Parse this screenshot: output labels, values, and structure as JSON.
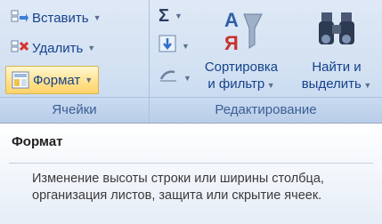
{
  "cells_group": {
    "insert_label": "Вставить",
    "delete_label": "Удалить",
    "format_label": "Формат",
    "caption": "Ячейки"
  },
  "editing_group": {
    "sum_icon": "Σ",
    "sort_label_line1": "Сортировка",
    "sort_label_line2": "и фильтр",
    "find_label_line1": "Найти и",
    "find_label_line2": "выделить",
    "caption": "Редактирование"
  },
  "tooltip": {
    "title": "Формат",
    "body": "Изменение высоты строки или ширины столбца, организация листов, защита или скрытие ячеек."
  },
  "colors": {
    "ribbon_bg": "#d3e1f2",
    "active_button": "#ffe08a",
    "text": "#15428b"
  }
}
